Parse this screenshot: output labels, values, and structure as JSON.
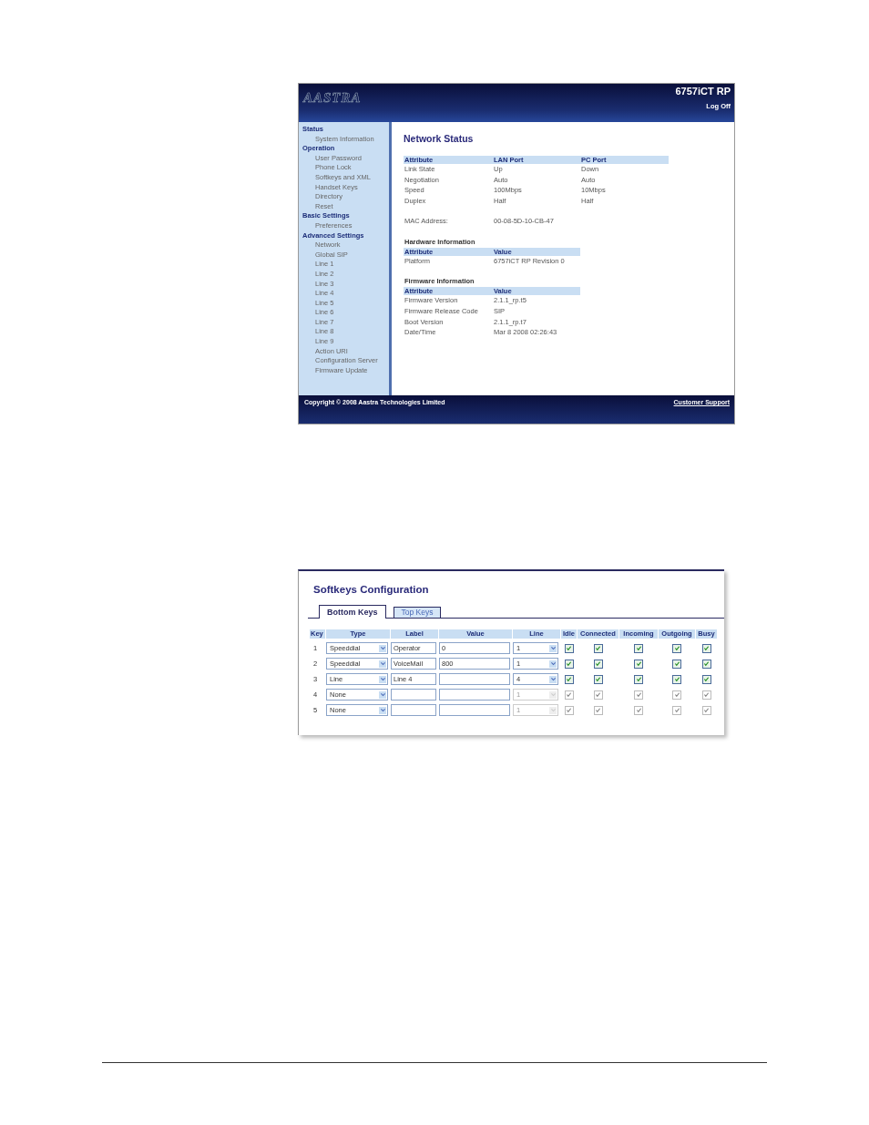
{
  "status_screen": {
    "logo": "AASTRA",
    "model": "6757iCT RP",
    "log_off": "Log Off",
    "sidebar": [
      {
        "heading": "Status",
        "items": [
          "System Information"
        ]
      },
      {
        "heading": "Operation",
        "items": [
          "User Password",
          "Phone Lock",
          "Softkeys and XML",
          "Handset Keys",
          "Directory",
          "Reset"
        ]
      },
      {
        "heading": "Basic Settings",
        "items": [
          "Preferences"
        ]
      },
      {
        "heading": "Advanced Settings",
        "items": [
          "Network",
          "Global SIP",
          "Line 1",
          "Line 2",
          "Line 3",
          "Line 4",
          "Line 5",
          "Line 6",
          "Line 7",
          "Line 8",
          "Line 9",
          "Action URI",
          "Configuration Server",
          "Firmware Update"
        ]
      }
    ],
    "title": "Network Status",
    "network_table": {
      "columns": [
        "Attribute",
        "LAN Port",
        "PC Port"
      ],
      "rows": [
        [
          "Link State",
          "Up",
          "Down"
        ],
        [
          "Negotiation",
          "Auto",
          "Auto"
        ],
        [
          "Speed",
          "100Mbps",
          "10Mbps"
        ],
        [
          "Duplex",
          "Half",
          "Half"
        ]
      ]
    },
    "mac": {
      "label": "MAC Address:",
      "value": "00-08-5D-10-CB-47"
    },
    "sections": [
      {
        "title": "Hardware Information",
        "columns": [
          "Attribute",
          "Value"
        ],
        "rows": [
          [
            "Platform",
            "6757iCT RP Revision 0"
          ]
        ]
      },
      {
        "title": "Firmware Information",
        "columns": [
          "Attribute",
          "Value"
        ],
        "rows": [
          [
            "Firmware Version",
            "2.1.1_rp.t5"
          ],
          [
            "Firmware Release Code",
            "SIP"
          ],
          [
            "Boot Version",
            "2.1.1_rp.t7"
          ],
          [
            "Date/Time",
            "Mar 8 2008 02:26:43"
          ]
        ]
      }
    ],
    "copyright": "Copyright © 2008 Aastra Technologies Limited",
    "support_link": "Customer Support"
  },
  "softkeys_screen": {
    "title": "Softkeys Configuration",
    "tabs": [
      {
        "label": "Bottom Keys",
        "selected": true
      },
      {
        "label": "Top Keys",
        "selected": false
      }
    ],
    "columns": [
      "Key",
      "Type",
      "Label",
      "Value",
      "Line",
      "Idle",
      "Connected",
      "Incoming",
      "Outgoing",
      "Busy"
    ],
    "rows": [
      {
        "key": "1",
        "type": "Speeddial",
        "label": "Operator",
        "value": "0",
        "line": "1",
        "disabled": false,
        "states": [
          true,
          true,
          true,
          true,
          true
        ]
      },
      {
        "key": "2",
        "type": "Speeddial",
        "label": "VoiceMail",
        "value": "800",
        "line": "1",
        "disabled": false,
        "states": [
          true,
          true,
          true,
          true,
          true
        ]
      },
      {
        "key": "3",
        "type": "Line",
        "label": "Line 4",
        "value": "",
        "line": "4",
        "disabled": false,
        "states": [
          true,
          true,
          true,
          true,
          true
        ]
      },
      {
        "key": "4",
        "type": "None",
        "label": "",
        "value": "",
        "line": "1",
        "disabled": true,
        "states": [
          true,
          true,
          true,
          true,
          true
        ]
      },
      {
        "key": "5",
        "type": "None",
        "label": "",
        "value": "",
        "line": "1",
        "disabled": true,
        "states": [
          true,
          true,
          true,
          true,
          true
        ]
      }
    ]
  }
}
